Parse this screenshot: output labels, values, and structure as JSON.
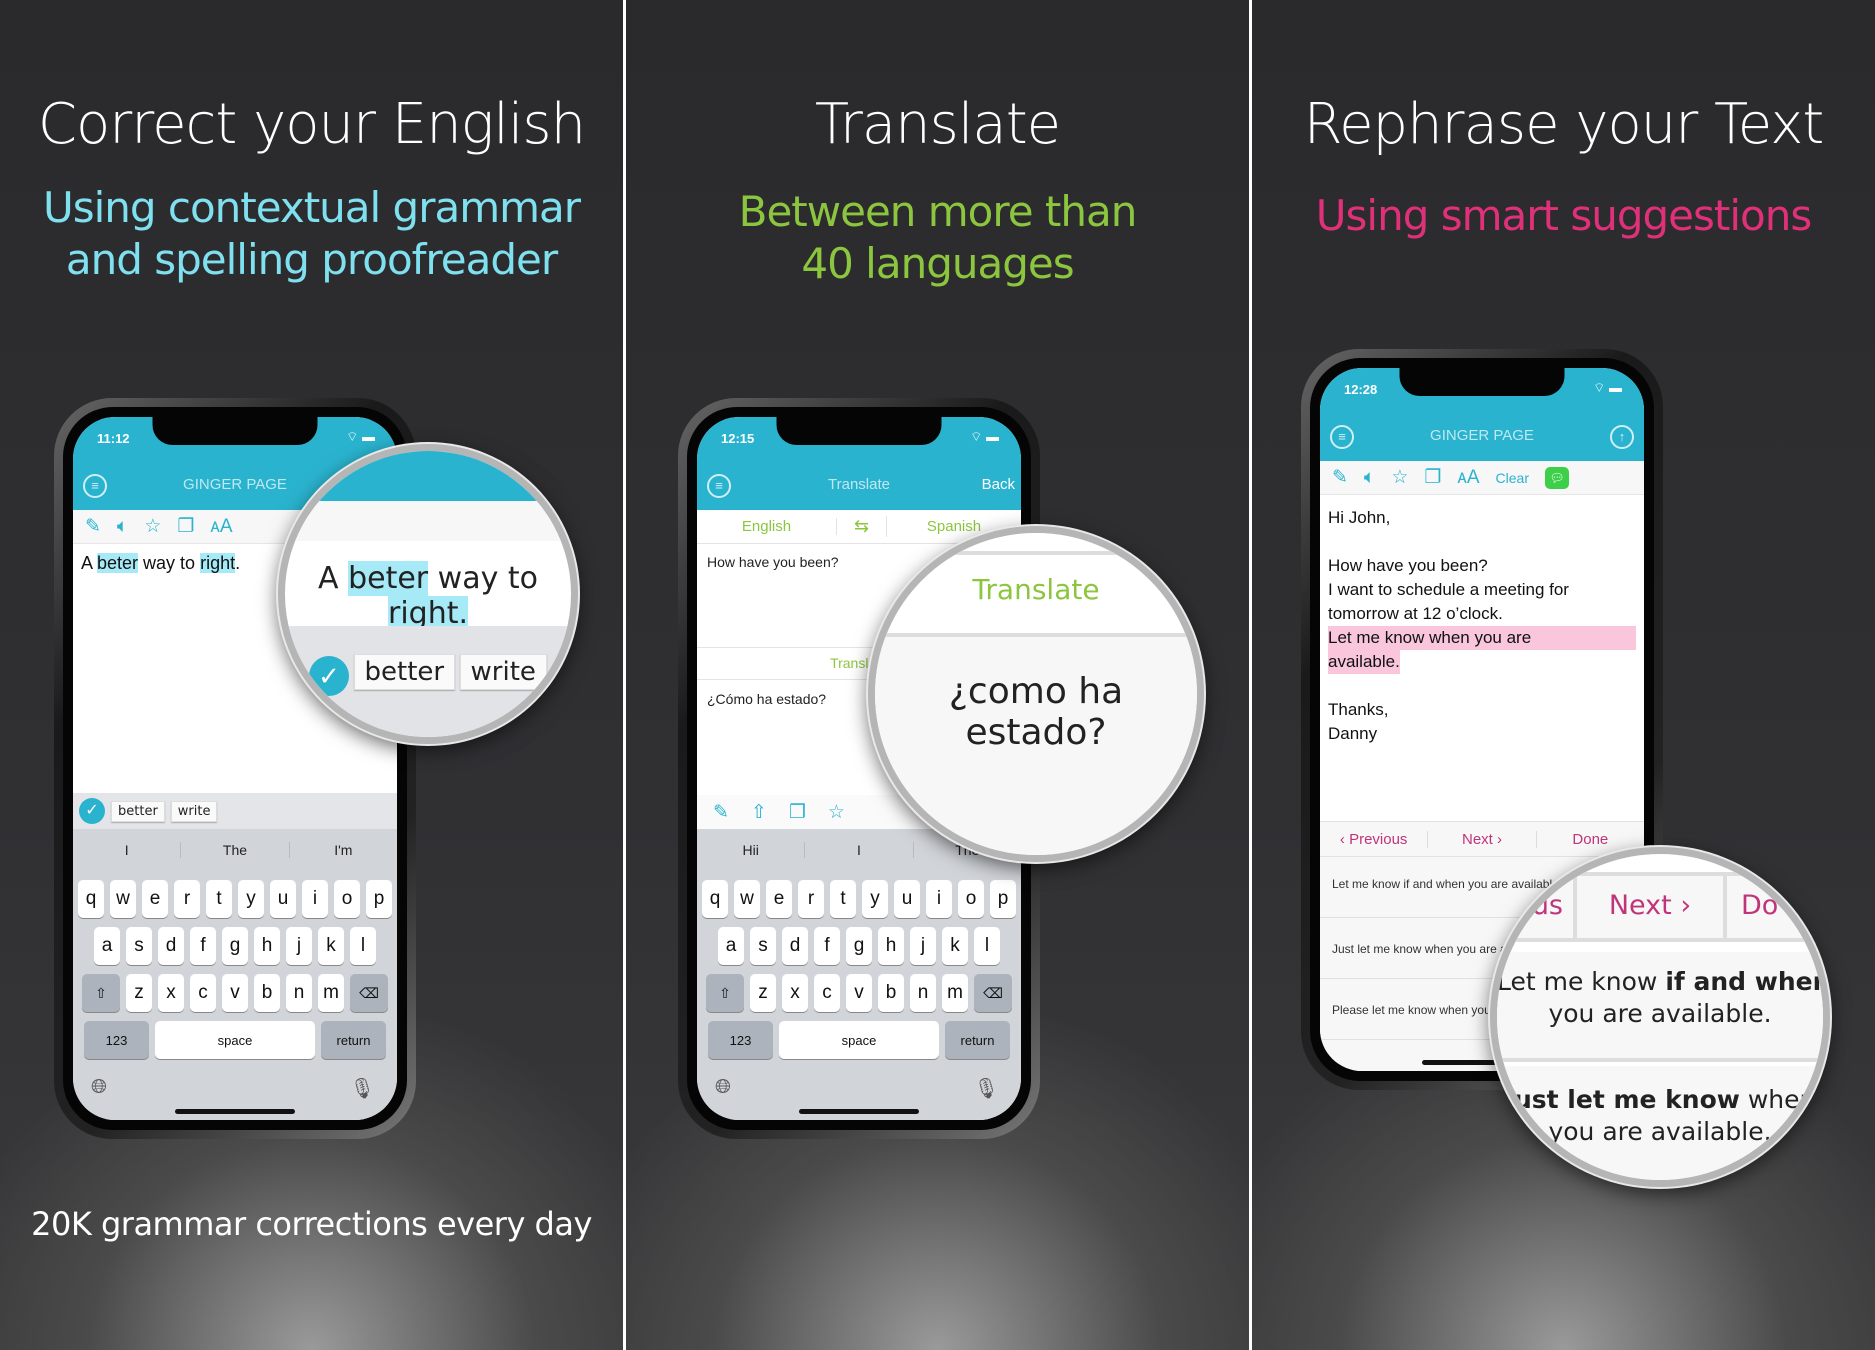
{
  "colors": {
    "teal": "#2ab3cf",
    "cyan_text": "#7fe0f0",
    "green": "#8cc63f",
    "pink": "#e0307a"
  },
  "panel1": {
    "title": "Correct your English",
    "subtitle_lines": [
      "Using contextual grammar",
      "and spelling proofreader"
    ],
    "footer": "20K grammar corrections every day",
    "phone": {
      "time": "11:12",
      "logo": "GINGER PAGE",
      "tools": [
        "pen-icon",
        "speaker-icon",
        "star-icon",
        "copy-icon",
        "font-size-icon"
      ],
      "text": {
        "w1": "A ",
        "w2": "beter",
        "w3": " way to ",
        "w4": "right",
        "w5": "."
      },
      "suggestions": [
        "better",
        "write"
      ],
      "predictions": [
        "I",
        "The",
        "I'm"
      ]
    },
    "magnifier": {
      "text": {
        "w1": "A ",
        "w2": "beter",
        "w3": " way to ",
        "w4": "right."
      },
      "suggestions": [
        "better",
        "write"
      ]
    }
  },
  "panel2": {
    "title": "Translate",
    "subtitle_lines": [
      "Between more than",
      "40 languages"
    ],
    "phone": {
      "time": "12:15",
      "header_title": "Translate",
      "back": "Back",
      "source_lang": "English",
      "target_lang": "Spanish",
      "input": "How have you been?",
      "translate_button": "Translate",
      "output": "¿Cómo ha estado?",
      "tools": [
        "pen-icon",
        "upload-icon",
        "copy-icon",
        "star-icon"
      ],
      "predictions": [
        "Hii",
        "I",
        "The"
      ]
    },
    "magnifier": {
      "translate_button": "Translate",
      "output": "¿como ha estado?"
    }
  },
  "panel3": {
    "title": "Rephrase your Text",
    "subtitle_lines": [
      "Using smart suggestions"
    ],
    "phone": {
      "time": "12:28",
      "logo": "GINGER PAGE",
      "clear": "Clear",
      "lines": [
        "Hi John,",
        "",
        "How have you been?",
        "I want to schedule a meeting for",
        "tomorrow at 12 o’clock."
      ],
      "highlight_lines": [
        "Let me know when you are",
        "available."
      ],
      "closing": [
        "",
        "Thanks,",
        "Danny"
      ],
      "nav": {
        "previous": "Previous",
        "next": "Next",
        "done": "Done"
      },
      "rephrasings": [
        "Let me know if and when you are available.",
        "Just let me know when you are available.",
        "Please let me know when you are available."
      ]
    },
    "magnifier": {
      "prev_fragment": "us",
      "next": "Next",
      "done_fragment": "Do",
      "s1a": "Let me know ",
      "s1b": "if and when",
      "s1c": "you are available.",
      "s2a": "Just let me know",
      "s2b": " when",
      "s2c": "you are available."
    }
  },
  "keyboard": {
    "rows": [
      [
        "q",
        "w",
        "e",
        "r",
        "t",
        "y",
        "u",
        "i",
        "o",
        "p"
      ],
      [
        "a",
        "s",
        "d",
        "f",
        "g",
        "h",
        "j",
        "k",
        "l"
      ],
      [
        "z",
        "x",
        "c",
        "v",
        "b",
        "n",
        "m"
      ]
    ],
    "numbers": "123",
    "space": "space",
    "return": "return"
  }
}
